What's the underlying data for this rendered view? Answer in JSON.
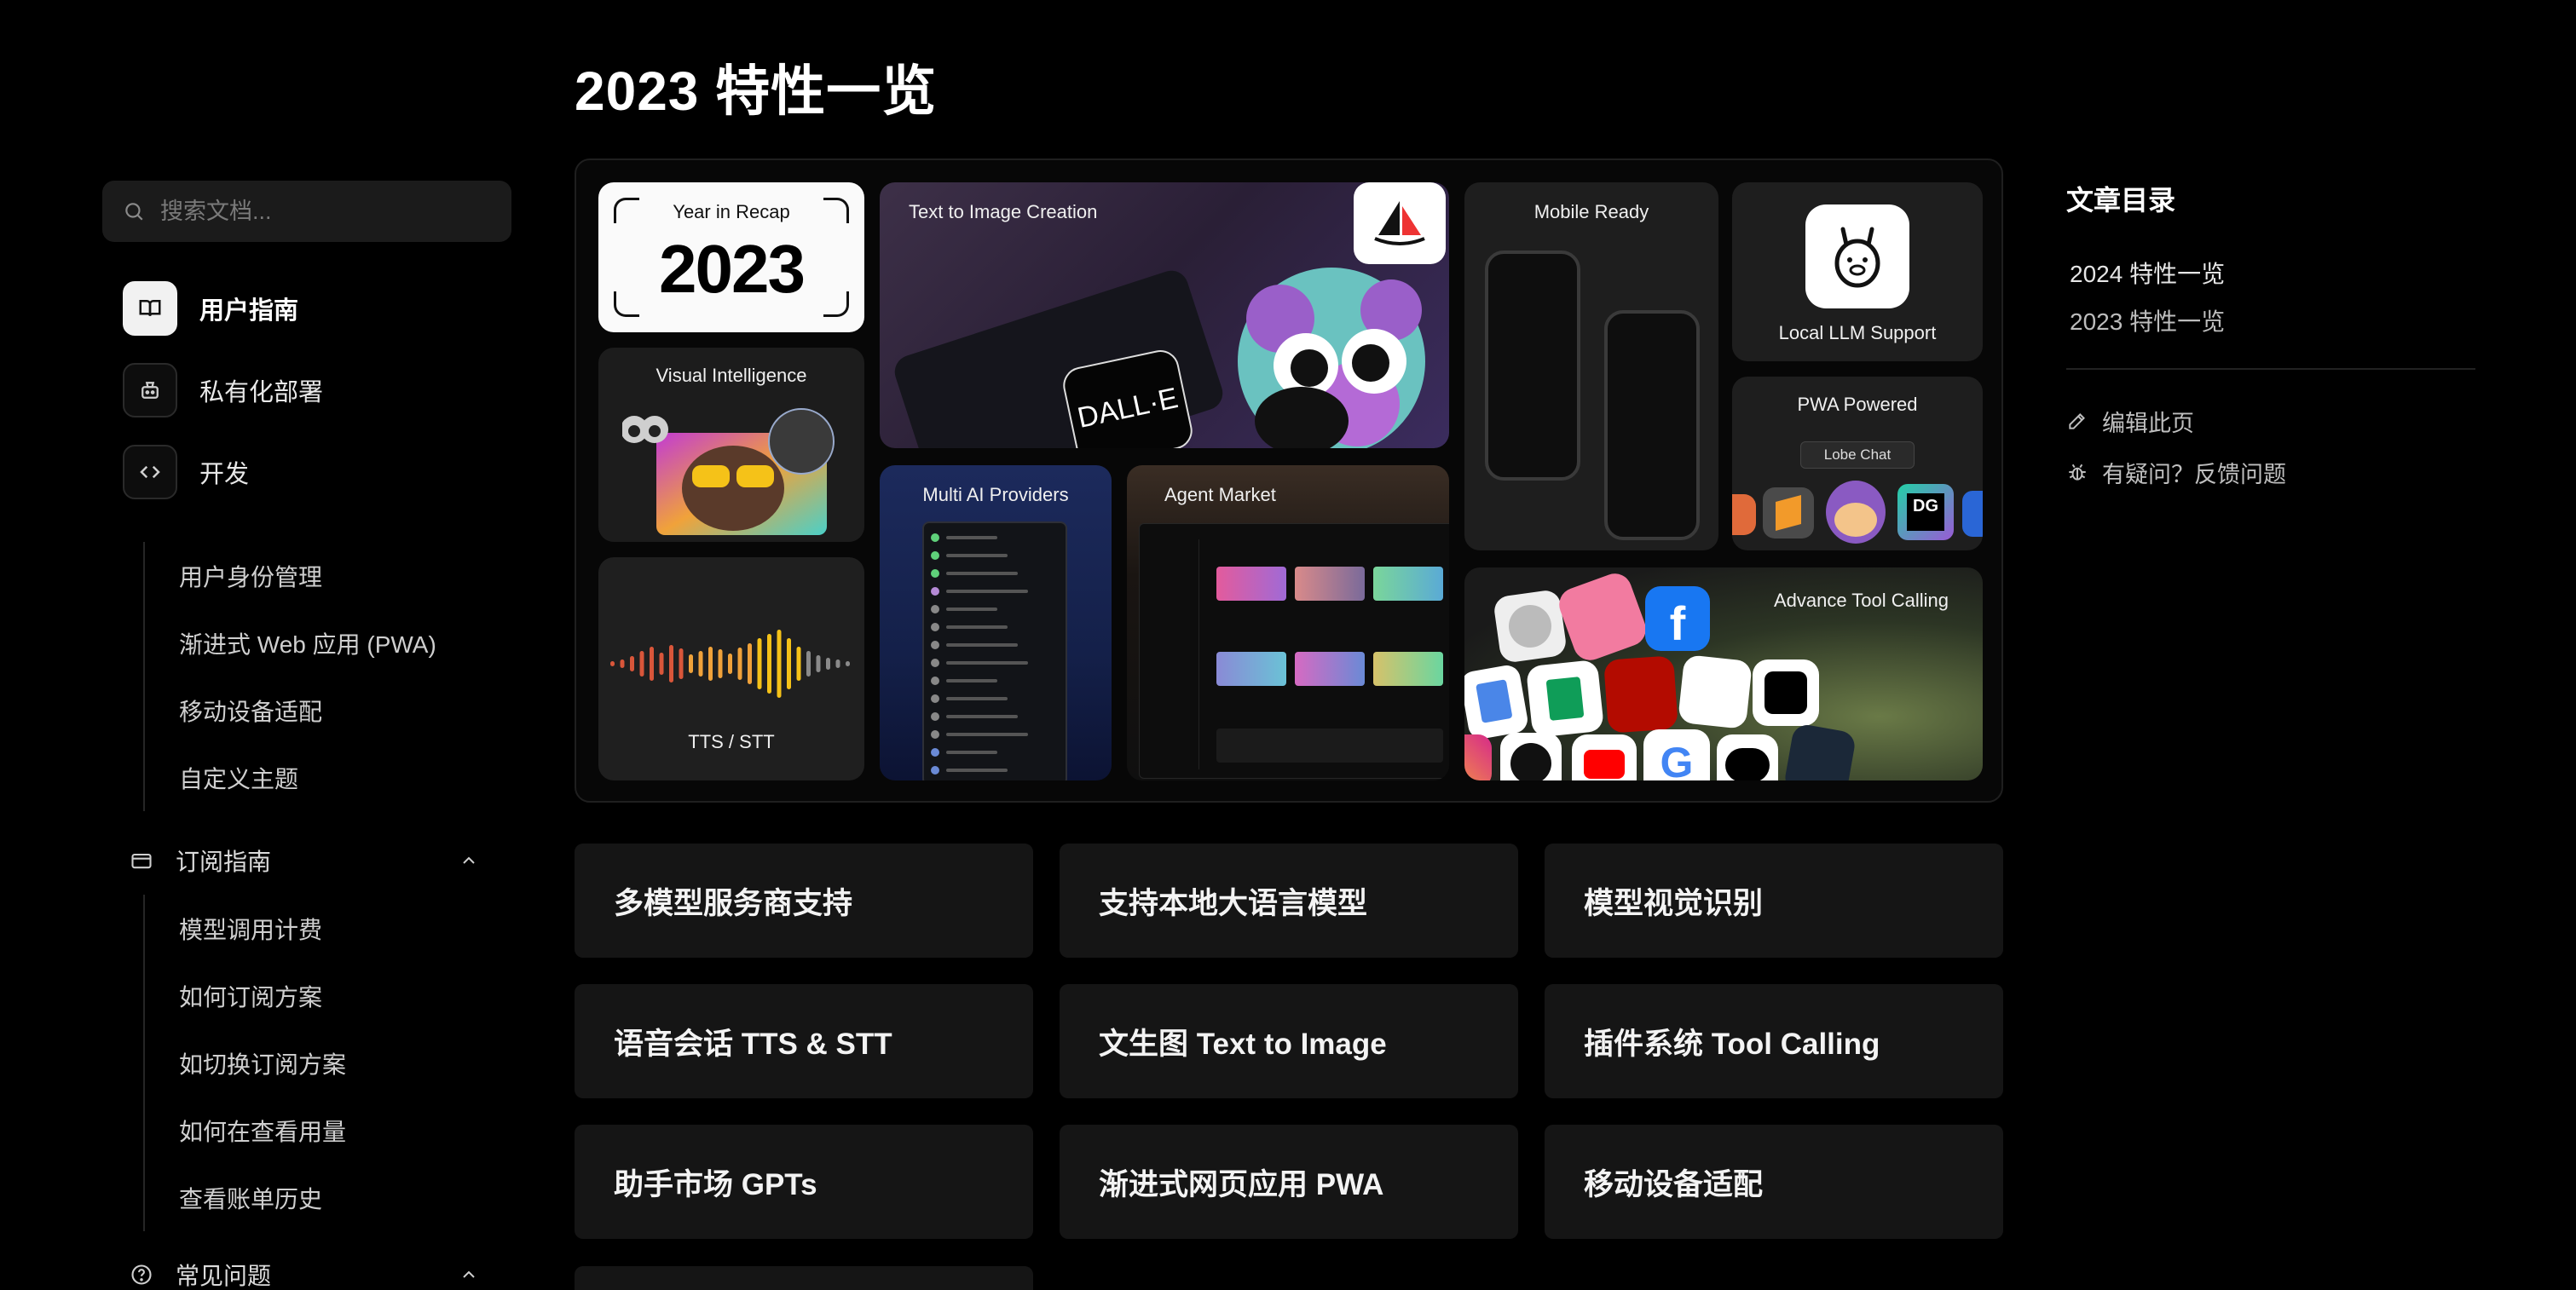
{
  "search": {
    "placeholder": "搜索文档..."
  },
  "nav": {
    "top": [
      {
        "label": "用户指南",
        "icon": "book-icon",
        "active": true
      },
      {
        "label": "私有化部署",
        "icon": "robot-icon",
        "active": false
      },
      {
        "label": "开发",
        "icon": "code-icon",
        "active": false
      }
    ],
    "sub_items": [
      "用户身份管理",
      "渐进式 Web 应用 (PWA)",
      "移动设备适配",
      "自定义主题"
    ],
    "group_subscription": {
      "label": "订阅指南",
      "icon": "card-icon"
    },
    "subscription_items": [
      "模型调用计费",
      "如何订阅方案",
      "如切换订阅方案",
      "如何在查看用量",
      "查看账单历史"
    ],
    "group_faq": {
      "label": "常见问题",
      "icon": "help-icon"
    }
  },
  "main": {
    "title": "2023 特性一览",
    "hero": {
      "recap_small": "Year in Recap",
      "recap_big": "2023",
      "visual": "Visual Intelligence",
      "tts": "TTS / STT",
      "t2i": "Text to Image Creation",
      "multi": "Multi AI Providers",
      "agent": "Agent Market",
      "mobile": "Mobile Ready",
      "llm": "Local LLM Support",
      "pwa": "PWA Powered",
      "pwa_chip": "Lobe Chat",
      "tool": "Advance Tool Calling",
      "dalle": "DALL·E",
      "dg": "DG"
    },
    "cards": [
      "多模型服务商支持",
      "支持本地大语言模型",
      "模型视觉识别",
      "语音会话 TTS & STT",
      "文生图 Text to Image",
      "插件系统 Tool Calling",
      "助手市场 GPTs",
      "渐进式网页应用 PWA",
      "移动设备适配"
    ]
  },
  "toc": {
    "title": "文章目录",
    "items": [
      "2024 特性一览",
      "2023 特性一览"
    ],
    "edit": "编辑此页",
    "feedback": "有疑问？反馈问题"
  }
}
